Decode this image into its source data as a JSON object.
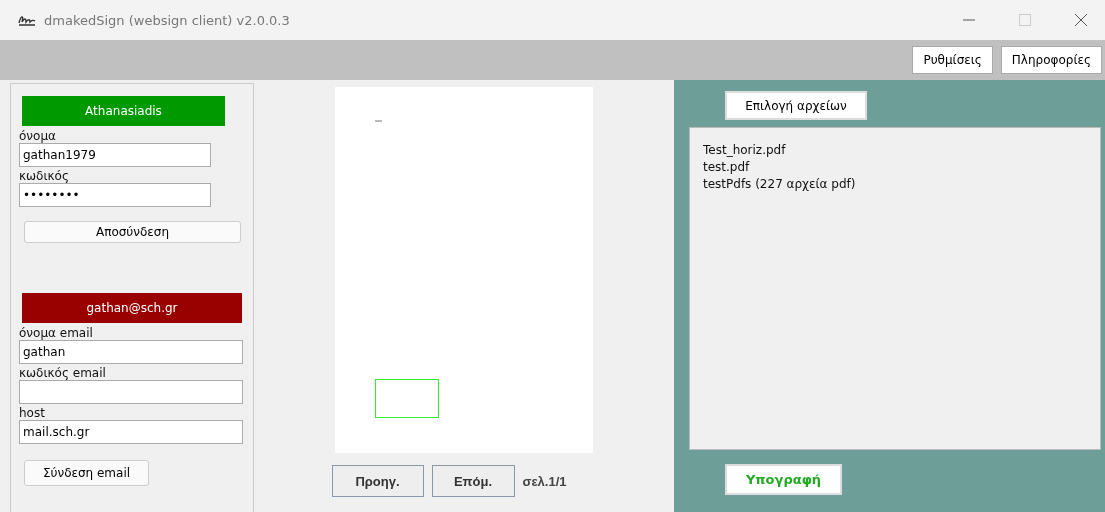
{
  "window": {
    "title": "dmakedSign (websign client) v2.0.0.3"
  },
  "toolbar": {
    "buttons": [
      "Ρυθμίσεις",
      "Πληροφορίες"
    ]
  },
  "accounts": [
    {
      "header": "Athanasiadis",
      "color": "#009900",
      "fields": [
        {
          "label": "όνομα",
          "value": "gathan1979"
        },
        {
          "label": "κωδικός",
          "value": "••••••••"
        }
      ],
      "button": "Αποσύνδεση"
    },
    {
      "header": "gathan@sch.gr",
      "color": "#990000",
      "fields": [
        {
          "label": "όνομα email",
          "value": "gathan"
        },
        {
          "label": "κωδικός email"
        },
        {
          "label": "host",
          "value": "mail.sch.gr"
        }
      ],
      "button": "Σύνδεση email"
    }
  ],
  "preview": {
    "prev": "Προηγ.",
    "next": "Επόμ.",
    "page": "σελ.1/1"
  },
  "files": {
    "choose": "Επιλογή αρχείων",
    "items": [
      "Test_horiz.pdf",
      "test.pdf",
      "testPdfs (227 αρχεία pdf)"
    ],
    "sign": "Υπογραφή"
  }
}
